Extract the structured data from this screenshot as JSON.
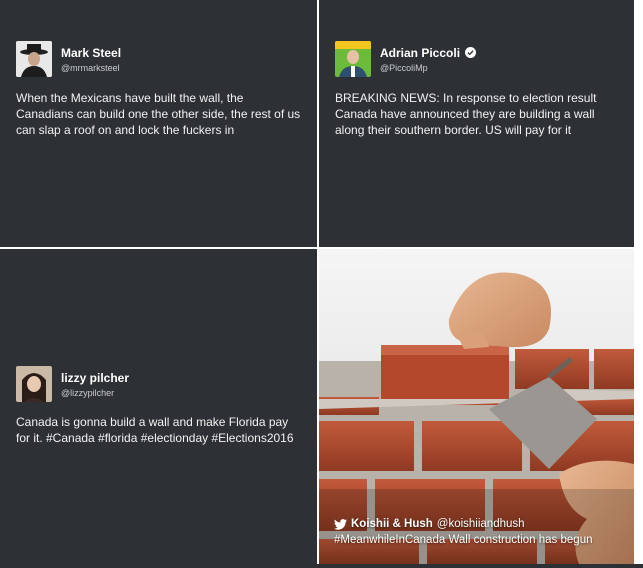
{
  "tweets": [
    {
      "name": "Mark Steel",
      "handle": "@mrmarksteel",
      "text": "When the Mexicans have built the wall, the Canadians can build one the other side, the rest of us can slap a roof on and lock the fuckers in"
    },
    {
      "name": "Adrian Piccoli",
      "handle": "@PiccoliMp",
      "verified": true,
      "text": "BREAKING NEWS: In response to election result Canada have announced they are building a wall along their southern border. US will pay for it"
    },
    {
      "name": "lizzy pilcher",
      "handle": "@lizzypilcher",
      "text": "Canada is gonna build a wall and make Florida pay for it. #Canada #florida #electionday #Elections2016"
    }
  ],
  "media_tweet": {
    "name": "Koishii & Hush",
    "handle": "@koishiiandhush",
    "text": "#MeanwhileInCanada Wall construction has begun",
    "icon": "twitter-bird-icon"
  },
  "colors": {
    "card_bg": "#2d3034",
    "text": "#ffffff",
    "handle": "#c9ccd0",
    "brick": "#b34a2e"
  }
}
